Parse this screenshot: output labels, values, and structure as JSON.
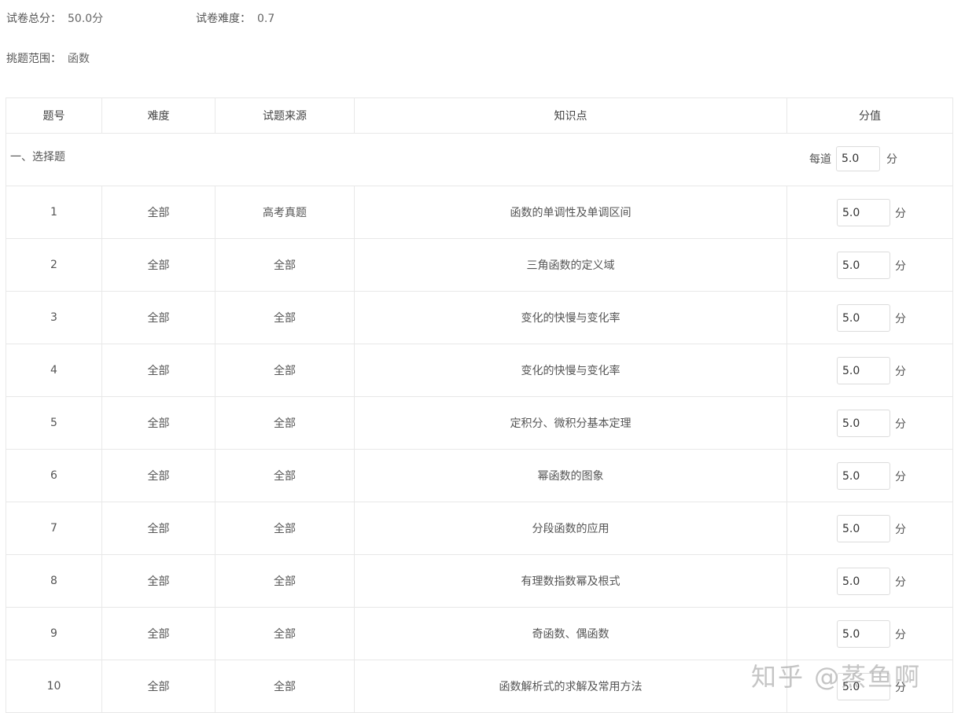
{
  "summary": {
    "total_score_label": "试卷总分：",
    "total_score_value": "50.0分",
    "difficulty_label": "试卷难度：",
    "difficulty_value": "0.7",
    "scope_label": "挑题范围：",
    "scope_value": "函数"
  },
  "table": {
    "headers": {
      "number": "题号",
      "difficulty": "难度",
      "source": "试题来源",
      "knowledge": "知识点",
      "score": "分值"
    },
    "section": {
      "title": "一、选择题",
      "per_label": "每道",
      "per_value": "5.0",
      "unit": "分"
    },
    "unit": "分",
    "rows": [
      {
        "num": "1",
        "difficulty": "全部",
        "source": "高考真题",
        "knowledge": "函数的单调性及单调区间",
        "score": "5.0"
      },
      {
        "num": "2",
        "difficulty": "全部",
        "source": "全部",
        "knowledge": "三角函数的定义域",
        "score": "5.0"
      },
      {
        "num": "3",
        "difficulty": "全部",
        "source": "全部",
        "knowledge": "变化的快慢与变化率",
        "score": "5.0"
      },
      {
        "num": "4",
        "difficulty": "全部",
        "source": "全部",
        "knowledge": "变化的快慢与变化率",
        "score": "5.0"
      },
      {
        "num": "5",
        "difficulty": "全部",
        "source": "全部",
        "knowledge": "定积分、微积分基本定理",
        "score": "5.0"
      },
      {
        "num": "6",
        "difficulty": "全部",
        "source": "全部",
        "knowledge": "幂函数的图象",
        "score": "5.0"
      },
      {
        "num": "7",
        "difficulty": "全部",
        "source": "全部",
        "knowledge": "分段函数的应用",
        "score": "5.0"
      },
      {
        "num": "8",
        "difficulty": "全部",
        "source": "全部",
        "knowledge": "有理数指数幂及根式",
        "score": "5.0"
      },
      {
        "num": "9",
        "difficulty": "全部",
        "source": "全部",
        "knowledge": "奇函数、偶函数",
        "score": "5.0"
      },
      {
        "num": "10",
        "difficulty": "全部",
        "source": "全部",
        "knowledge": "函数解析式的求解及常用方法",
        "score": "5.0"
      }
    ]
  },
  "watermark": "知乎 @蒸鱼啊"
}
